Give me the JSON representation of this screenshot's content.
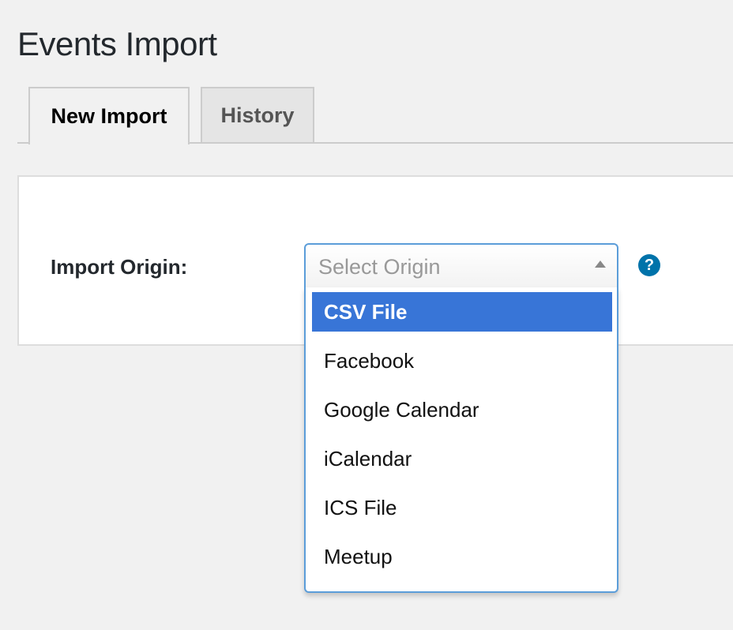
{
  "page": {
    "title": "Events Import"
  },
  "tabs": [
    {
      "label": "New Import",
      "active": true
    },
    {
      "label": "History",
      "active": false
    }
  ],
  "form": {
    "import_origin_label": "Import Origin:",
    "select": {
      "placeholder": "Select Origin",
      "expanded": true,
      "highlighted_option": "CSV File",
      "options": [
        "CSV File",
        "Facebook",
        "Google Calendar",
        "iCalendar",
        "ICS File",
        "Meetup"
      ]
    },
    "help_icon": {
      "glyph": "?",
      "icon": "help-circle-icon"
    }
  },
  "colors": {
    "accent": "#3875d7",
    "focus_border": "#5b9dd9",
    "help": "#0073aa",
    "background": "#f1f1f1"
  }
}
